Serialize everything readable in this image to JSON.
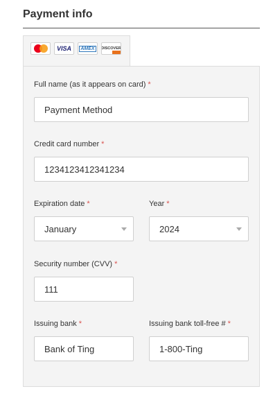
{
  "section": {
    "title": "Payment info"
  },
  "cards": [
    "mastercard-icon",
    "visa-icon",
    "amex-icon",
    "discover-icon"
  ],
  "card_text": {
    "visa": "VISA",
    "amex": "AMEX",
    "discover": "DISCOVER"
  },
  "form": {
    "full_name": {
      "label": "Full name (as it appears on card)",
      "value": "Payment Method"
    },
    "card_number": {
      "label": "Credit card number",
      "value": "1234123412341234"
    },
    "exp_month": {
      "label": "Expiration date",
      "value": "January"
    },
    "exp_year": {
      "label": "Year",
      "value": "2024"
    },
    "cvv": {
      "label": "Security number (CVV)",
      "value": "111"
    },
    "bank": {
      "label": "Issuing bank",
      "value": "Bank of Ting"
    },
    "bank_phone": {
      "label": "Issuing bank toll-free #",
      "value": "1-800-Ting"
    },
    "required_mark": "*"
  },
  "colors": {
    "required": "#d9534f",
    "panel": "#f4f4f4",
    "border": "#dddddd"
  }
}
